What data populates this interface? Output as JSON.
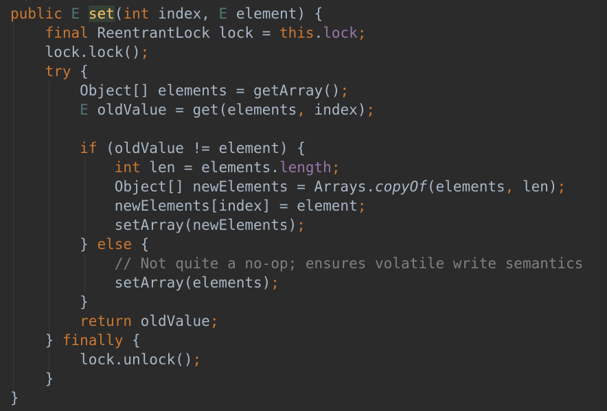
{
  "editor": {
    "theme_colors": {
      "background": "#2b2b2b",
      "keyword": "#cc7832",
      "text": "#a9b7c6",
      "generic": "#507874",
      "method_decl": "#ffc66d",
      "field": "#9876aa",
      "comment": "#808080"
    },
    "code_lines": [
      [
        {
          "t": "public",
          "c": "kw"
        },
        {
          "t": " ",
          "c": "plain"
        },
        {
          "t": "E",
          "c": "gen"
        },
        {
          "t": " ",
          "c": "plain"
        },
        {
          "t": "set",
          "c": "fn"
        },
        {
          "t": "(",
          "c": "plain"
        },
        {
          "t": "int",
          "c": "kw"
        },
        {
          "t": " index, ",
          "c": "plain"
        },
        {
          "t": "E",
          "c": "gen"
        },
        {
          "t": " element) {",
          "c": "plain"
        }
      ],
      [
        {
          "t": "    ",
          "c": "plain"
        },
        {
          "t": "final",
          "c": "kw"
        },
        {
          "t": " ReentrantLock lock = ",
          "c": "plain"
        },
        {
          "t": "this",
          "c": "kw"
        },
        {
          "t": ".",
          "c": "plain"
        },
        {
          "t": "lock",
          "c": "field"
        },
        {
          "t": ";",
          "c": "punc"
        }
      ],
      [
        {
          "t": "    lock.lock()",
          "c": "plain"
        },
        {
          "t": ";",
          "c": "punc"
        }
      ],
      [
        {
          "t": "    ",
          "c": "plain"
        },
        {
          "t": "try",
          "c": "kw"
        },
        {
          "t": " {",
          "c": "plain"
        }
      ],
      [
        {
          "t": "        Object[] elements = getArray()",
          "c": "plain"
        },
        {
          "t": ";",
          "c": "punc"
        }
      ],
      [
        {
          "t": "        ",
          "c": "plain"
        },
        {
          "t": "E",
          "c": "gen"
        },
        {
          "t": " oldValue = get(elements",
          "c": "plain"
        },
        {
          "t": ",",
          "c": "punc"
        },
        {
          "t": " index)",
          "c": "plain"
        },
        {
          "t": ";",
          "c": "punc"
        }
      ],
      [],
      [
        {
          "t": "        ",
          "c": "plain"
        },
        {
          "t": "if",
          "c": "kw"
        },
        {
          "t": " (oldValue != element) {",
          "c": "plain"
        }
      ],
      [
        {
          "t": "            ",
          "c": "plain"
        },
        {
          "t": "int",
          "c": "kw"
        },
        {
          "t": " len = elements.",
          "c": "plain"
        },
        {
          "t": "length",
          "c": "field"
        },
        {
          "t": ";",
          "c": "punc"
        }
      ],
      [
        {
          "t": "            Object[] newElements = Arrays.",
          "c": "plain"
        },
        {
          "t": "copyOf",
          "c": "italic"
        },
        {
          "t": "(elements",
          "c": "plain"
        },
        {
          "t": ",",
          "c": "punc"
        },
        {
          "t": " len)",
          "c": "plain"
        },
        {
          "t": ";",
          "c": "punc"
        }
      ],
      [
        {
          "t": "            newElements[index] = element",
          "c": "plain"
        },
        {
          "t": ";",
          "c": "punc"
        }
      ],
      [
        {
          "t": "            setArray(newElements)",
          "c": "plain"
        },
        {
          "t": ";",
          "c": "punc"
        }
      ],
      [
        {
          "t": "        } ",
          "c": "plain"
        },
        {
          "t": "else",
          "c": "kw"
        },
        {
          "t": " {",
          "c": "plain"
        }
      ],
      [
        {
          "t": "            ",
          "c": "plain"
        },
        {
          "t": "// Not quite a no-op; ensures volatile write semantics",
          "c": "comment"
        }
      ],
      [
        {
          "t": "            setArray(elements)",
          "c": "plain"
        },
        {
          "t": ";",
          "c": "punc"
        }
      ],
      [
        {
          "t": "        }",
          "c": "plain"
        }
      ],
      [
        {
          "t": "        ",
          "c": "plain"
        },
        {
          "t": "return",
          "c": "kw"
        },
        {
          "t": " oldValue",
          "c": "plain"
        },
        {
          "t": ";",
          "c": "punc"
        }
      ],
      [
        {
          "t": "    } ",
          "c": "plain"
        },
        {
          "t": "finally",
          "c": "kw"
        },
        {
          "t": " {",
          "c": "plain"
        }
      ],
      [
        {
          "t": "        lock.unlock()",
          "c": "plain"
        },
        {
          "t": ";",
          "c": "punc"
        }
      ],
      [
        {
          "t": "    }",
          "c": "plain"
        }
      ],
      [
        {
          "t": "}",
          "c": "plain"
        }
      ]
    ]
  }
}
